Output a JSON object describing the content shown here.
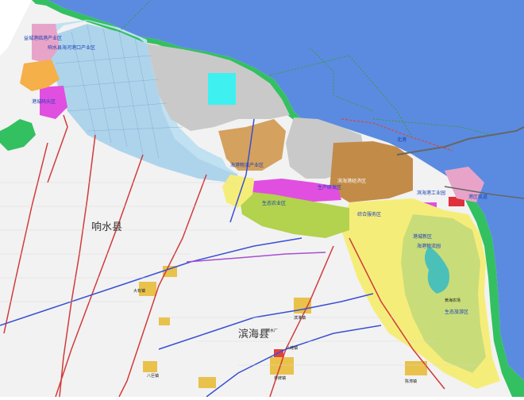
{
  "map": {
    "counties": [
      {
        "id": "xiangshui",
        "label": "响水县"
      },
      {
        "id": "binhai",
        "label": "滨海县"
      }
    ],
    "zone_labels": [
      {
        "id": "tl-zone",
        "label": "益城港临港产业区"
      },
      {
        "id": "tl-zone-2",
        "label": "响水县海河港口产业区"
      },
      {
        "id": "port-area",
        "label": "港城码头区"
      },
      {
        "id": "mid-zone",
        "label": "生态农业区"
      },
      {
        "id": "mid-zone-2",
        "label": "海港物流产业区"
      },
      {
        "id": "center-zone",
        "label": "滨海港经济区"
      },
      {
        "id": "east-zone",
        "label": "滨海港工业园"
      },
      {
        "id": "se-zone",
        "label": "港城新区"
      },
      {
        "id": "south-zone",
        "label": "海港物流园"
      },
      {
        "id": "se-zone-2",
        "label": "生态旅游区"
      },
      {
        "id": "port-east",
        "label": "港区航道"
      },
      {
        "id": "bay-lbl",
        "label": "北港"
      },
      {
        "id": "lake-lbl",
        "label": "生产研发区"
      },
      {
        "id": "west-lbl",
        "label": "综合服务区"
      }
    ],
    "place_labels": [
      {
        "id": "p1",
        "label": "八滩水厂"
      },
      {
        "id": "p2",
        "label": "八滩镇"
      },
      {
        "id": "p3",
        "label": "大有镇"
      },
      {
        "id": "p4",
        "label": "滨淮镇"
      },
      {
        "id": "p5",
        "label": "界牌镇"
      },
      {
        "id": "p6",
        "label": "陈涛镇"
      },
      {
        "id": "p7",
        "label": "八巨镇"
      },
      {
        "id": "p8",
        "label": "黄海农场"
      }
    ],
    "colors": {
      "sea": "#5b8be0",
      "land": "#f2f2f2",
      "residential": "#f5ed7a",
      "industrial_light": "#c9dc7a",
      "industrial_green": "#b3d24d",
      "storage": "#bfe1f1",
      "grey_zone": "#c9c9c9",
      "brown_zone": "#c28b48",
      "magenta_zone": "#e04fe0",
      "pink_zone": "#e8a4c8",
      "cyan_zone": "#3ff0f0",
      "green_coast": "#33c060",
      "road_red": "#d23a3a",
      "road_blue": "#3a4fd2",
      "road_purple": "#a64fd2"
    }
  }
}
